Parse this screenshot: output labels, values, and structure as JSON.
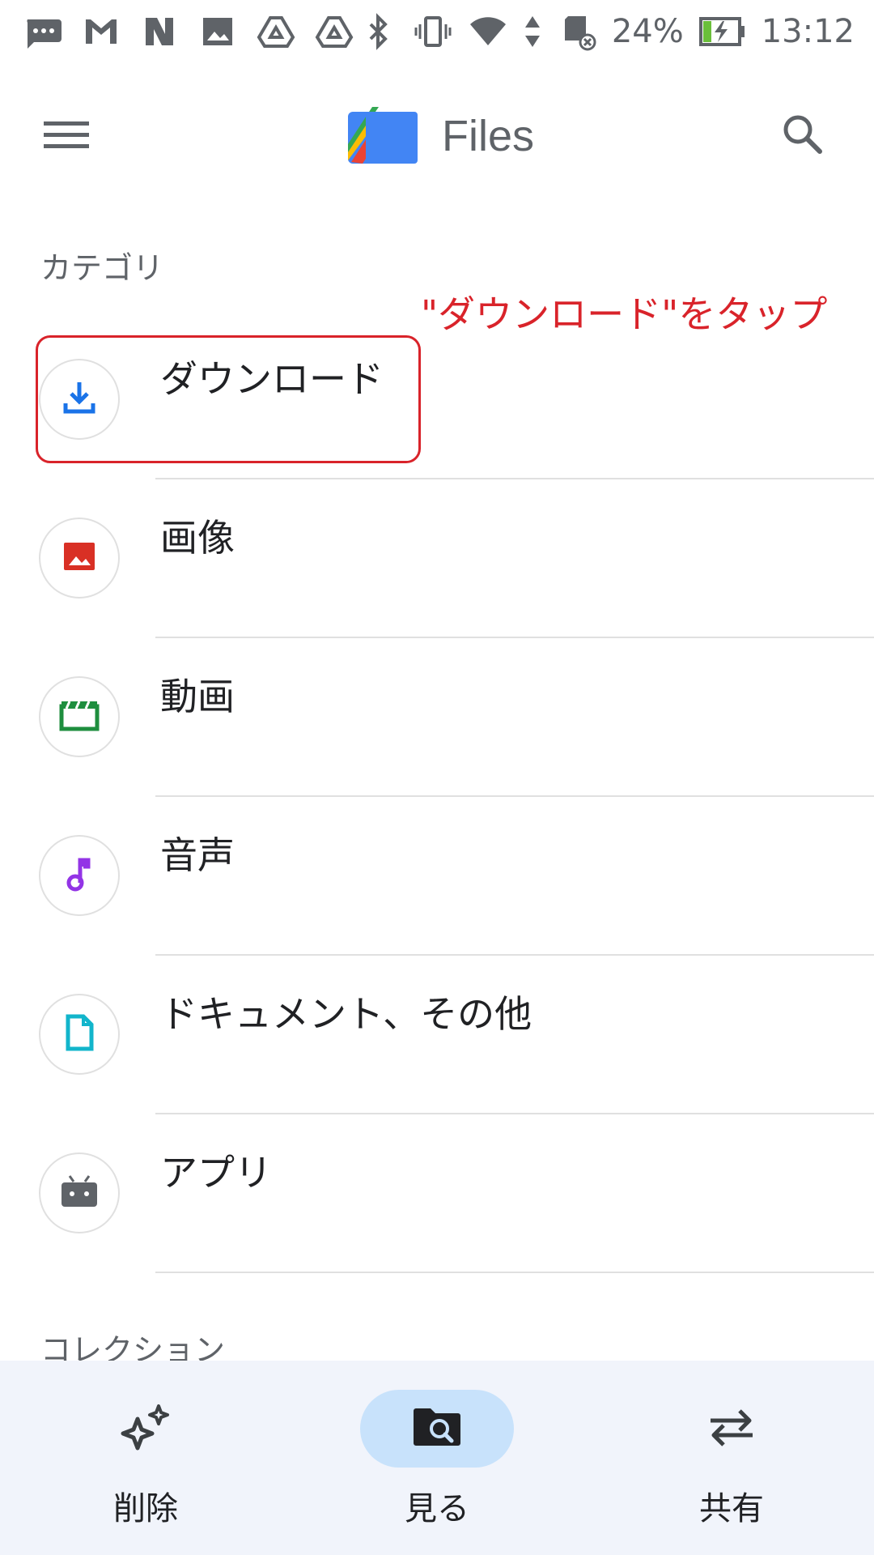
{
  "status_bar": {
    "left_icons": [
      "messages-icon",
      "gmail-icon",
      "nfc-icon",
      "gallery-icon",
      "drive-icon",
      "drive-icon"
    ],
    "right_icons": [
      "bluetooth-icon",
      "vibrate-icon",
      "wifi-icon",
      "data-arrows-icon",
      "sd-card-icon"
    ],
    "battery_percent": "24%",
    "battery_level": 0.24,
    "time": "13:12"
  },
  "app_bar": {
    "title": "Files",
    "menu_icon": "menu-icon",
    "search_icon": "search-icon"
  },
  "sections": {
    "categories_header": "カテゴリ",
    "collections_header": "コレクション"
  },
  "annotation": {
    "text": "\"ダウンロード\"をタップ",
    "color": "#d9232a"
  },
  "categories": [
    {
      "label": "ダウンロード",
      "icon": "download-icon",
      "color": "#1a73e8"
    },
    {
      "label": "画像",
      "icon": "image-icon",
      "color": "#d93025"
    },
    {
      "label": "動画",
      "icon": "video-icon",
      "color": "#1e8e3e"
    },
    {
      "label": "音声",
      "icon": "audio-icon",
      "color": "#9334e6"
    },
    {
      "label": "ドキュメント、その他",
      "icon": "document-icon",
      "color": "#12b5cb"
    },
    {
      "label": "アプリ",
      "icon": "android-icon",
      "color": "#5f6368"
    }
  ],
  "bottom_nav": {
    "items": [
      {
        "label": "削除",
        "icon": "sparkle-icon",
        "active": false
      },
      {
        "label": "見る",
        "icon": "browse-folder-icon",
        "active": true
      },
      {
        "label": "共有",
        "icon": "swap-arrows-icon",
        "active": false
      }
    ],
    "active_color": "#c8e2fb"
  }
}
